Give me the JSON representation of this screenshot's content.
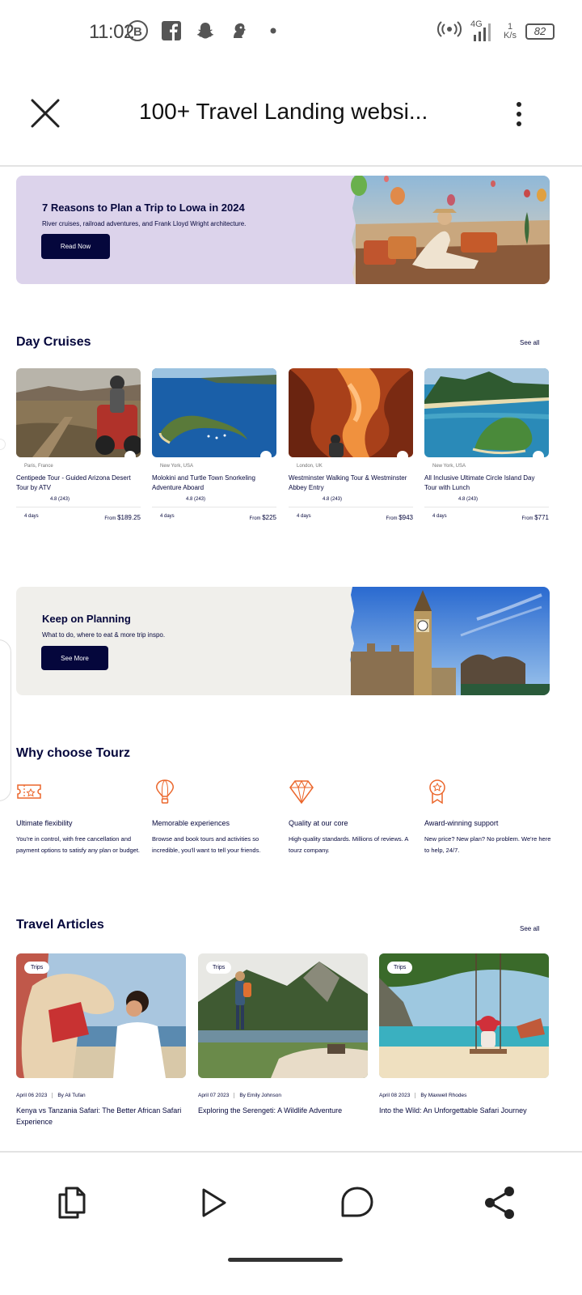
{
  "status_bar": {
    "time": "11:02",
    "network": "4G",
    "speed_value": "1",
    "speed_unit": "K/s",
    "battery": "82"
  },
  "header": {
    "title": "100+ Travel Landing websi..."
  },
  "banner1": {
    "title": "7 Reasons to Plan a Trip to Lowa in 2024",
    "subtitle": "River cruises, railroad adventures, and Frank Lloyd Wright architecture.",
    "button": "Read Now",
    "bg_color": "#dcd3eb"
  },
  "day_cruises": {
    "title": "Day Cruises",
    "see_all": "See all",
    "cards": [
      {
        "location": "Paris, France",
        "title": "Centipede Tour - Guided Arizona Desert Tour by ATV",
        "rating": "4.8 (243)",
        "duration": "4 days",
        "price_prefix": "From",
        "price": "$189.25"
      },
      {
        "location": "New York, USA",
        "title": "Molokini and Turtle Town Snorkeling Adventure Aboard",
        "rating": "4.8 (243)",
        "duration": "4 days",
        "price_prefix": "From",
        "price": "$225"
      },
      {
        "location": "London, UK",
        "title": "Westminster Walking Tour & Westminster Abbey Entry",
        "rating": "4.8 (243)",
        "duration": "4 days",
        "price_prefix": "From",
        "price": "$943"
      },
      {
        "location": "New York, USA",
        "title": "All Inclusive Ultimate Circle Island Day Tour with Lunch",
        "rating": "4.8 (243)",
        "duration": "4 days",
        "price_prefix": "From",
        "price": "$771"
      }
    ]
  },
  "banner2": {
    "title": "Keep on Planning",
    "subtitle": "What to do, where to eat & more trip inspo.",
    "button": "See More",
    "bg_color": "#f0efeb"
  },
  "why_choose": {
    "title": "Why choose Tourz",
    "accent": "#eb662b",
    "features": [
      {
        "title": "Ultimate flexibility",
        "text": "You're in control, with free cancellation and payment options to satisfy any plan or budget.",
        "icon": "ticket-icon"
      },
      {
        "title": "Memorable experiences",
        "text": "Browse and book tours and activities so incredible, you'll want to tell your friends.",
        "icon": "hot-air-balloon-icon"
      },
      {
        "title": "Quality at our core",
        "text": "High-quality standards. Millions of reviews. A tourz company.",
        "icon": "diamond-icon"
      },
      {
        "title": "Award-winning support",
        "text": "New price? New plan? No problem. We're here to help, 24/7.",
        "icon": "award-icon"
      }
    ]
  },
  "articles": {
    "title": "Travel Articles",
    "see_all": "See all",
    "items": [
      {
        "tag": "Trips",
        "date": "April 06 2023",
        "author": "By Ali Tufan",
        "title": "Kenya vs Tanzania Safari: The Better African Safari Experience"
      },
      {
        "tag": "Trips",
        "date": "April 07 2023",
        "author": "By Emily Johnson",
        "title": "Exploring the Serengeti: A Wildlife Adventure"
      },
      {
        "tag": "Trips",
        "date": "April 08 2023",
        "author": "By Maxwell Rhodes",
        "title": "Into the Wild: An Unforgettable Safari Journey"
      }
    ]
  },
  "bottom_bar": {
    "icons": [
      "copy-icon",
      "play-icon",
      "comment-icon",
      "share-icon"
    ]
  }
}
